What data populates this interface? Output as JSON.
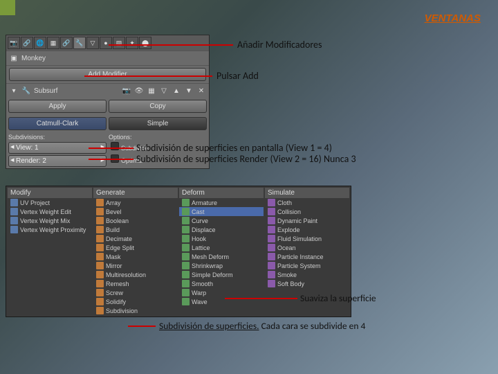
{
  "header": {
    "ventanas": "VENTANAS"
  },
  "panel1": {
    "object_name": "Monkey",
    "add_modifier": "Add Modifier",
    "subsurf_label": "Subsurf",
    "apply": "Apply",
    "copy": "Copy",
    "catmull": "Catmull-Clark",
    "simple": "Simple",
    "subdiv_label": "Subdivisions:",
    "options_label": "Options:",
    "view_field": "View: 1",
    "render_field": "Render: 2",
    "opt1": "Subdivide",
    "opt2": "Optimal"
  },
  "annotations": {
    "a1": "Añadir Modificadores",
    "a2": "Pulsar Add",
    "a3": "Subdivisión de superficies en pantalla (View 1 = 4)",
    "a4": "Subdivisión de superficies Render (View 2 = 16) Nunca 3",
    "a5": "Suaviza la superficie",
    "a6_pre": "Subdivisión de superficies.",
    "a6_post": " Cada cara se subdivide en 4"
  },
  "panel2": {
    "cols": {
      "modify": {
        "head": "Modify",
        "items": [
          "UV Project",
          "Vertex Weight Edit",
          "Vertex Weight Mix",
          "Vertex Weight Proximity"
        ]
      },
      "generate": {
        "head": "Generate",
        "items": [
          "Array",
          "Bevel",
          "Boolean",
          "Build",
          "Decimate",
          "Edge Split",
          "Mask",
          "Mirror",
          "Multiresolution",
          "Remesh",
          "Screw",
          "Solidify",
          "Subdivision"
        ]
      },
      "deform": {
        "head": "Deform",
        "items": [
          "Armature",
          "Cast",
          "Curve",
          "Displace",
          "Hook",
          "Lattice",
          "Mesh Deform",
          "Shrinkwrap",
          "Simple Deform",
          "Smooth",
          "Warp",
          "Wave"
        ]
      },
      "simulate": {
        "head": "Simulate",
        "items": [
          "Cloth",
          "Collision",
          "Dynamic Paint",
          "Explode",
          "Fluid Simulation",
          "Ocean",
          "Particle Instance",
          "Particle System",
          "Smoke",
          "Soft Body"
        ]
      }
    }
  }
}
